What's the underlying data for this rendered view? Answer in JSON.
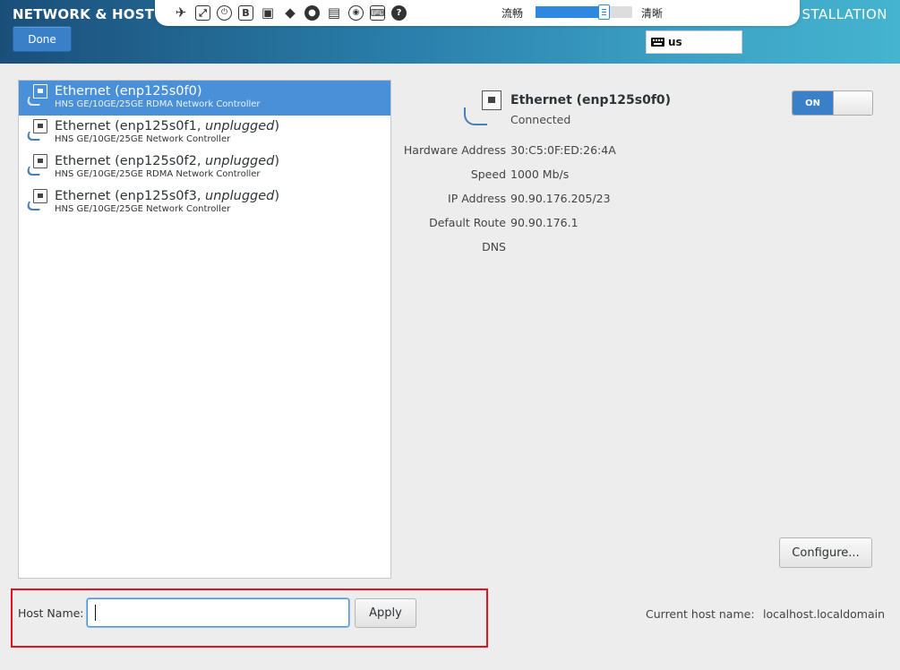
{
  "header": {
    "title": "NETWORK & HOST NA",
    "right_title": "STALLATION",
    "done_label": "Done",
    "keyboard_layout": "us"
  },
  "toolbar": {
    "quality_low": "流畅",
    "quality_high": "清晰",
    "quality_level": 0.7,
    "icons": [
      "pin-icon",
      "fullscreen-icon",
      "power-icon",
      "b-icon",
      "network-icon",
      "mouse-icon",
      "record-icon",
      "clipboard-icon",
      "video-icon",
      "keyboard-icon",
      "help-icon"
    ]
  },
  "devices": [
    {
      "name": "Ethernet (enp125s0f0)",
      "state": "",
      "desc": "HNS GE/10GE/25GE RDMA Network Controller",
      "selected": true
    },
    {
      "name": "Ethernet (enp125s0f1, ",
      "state": "unplugged",
      "desc": "HNS GE/10GE/25GE Network Controller",
      "selected": false
    },
    {
      "name": "Ethernet (enp125s0f2, ",
      "state": "unplugged",
      "desc": "HNS GE/10GE/25GE RDMA Network Controller",
      "selected": false
    },
    {
      "name": "Ethernet (enp125s0f3, ",
      "state": "unplugged",
      "desc": "HNS GE/10GE/25GE Network Controller",
      "selected": false
    }
  ],
  "detail": {
    "name": "Ethernet (enp125s0f0)",
    "status": "Connected",
    "toggle_label": "ON",
    "props": {
      "hw_key": "Hardware Address",
      "hw_val": "30:C5:0F:ED:26:4A",
      "speed_key": "Speed",
      "speed_val": "1000 Mb/s",
      "ip_key": "IP Address",
      "ip_val": "90.90.176.205/23",
      "route_key": "Default Route",
      "route_val": "90.90.176.1",
      "dns_key": "DNS",
      "dns_val": ""
    },
    "configure_label": "Configure..."
  },
  "hostname": {
    "label": "Host Name:",
    "value": "",
    "placeholder": "",
    "apply_label": "Apply",
    "current_label": "Current host name:",
    "current_value": "localhost.localdomain"
  },
  "colors": {
    "accent": "#3a80c9",
    "selection": "#4a90d9",
    "highlight_box": "#e3101d"
  }
}
